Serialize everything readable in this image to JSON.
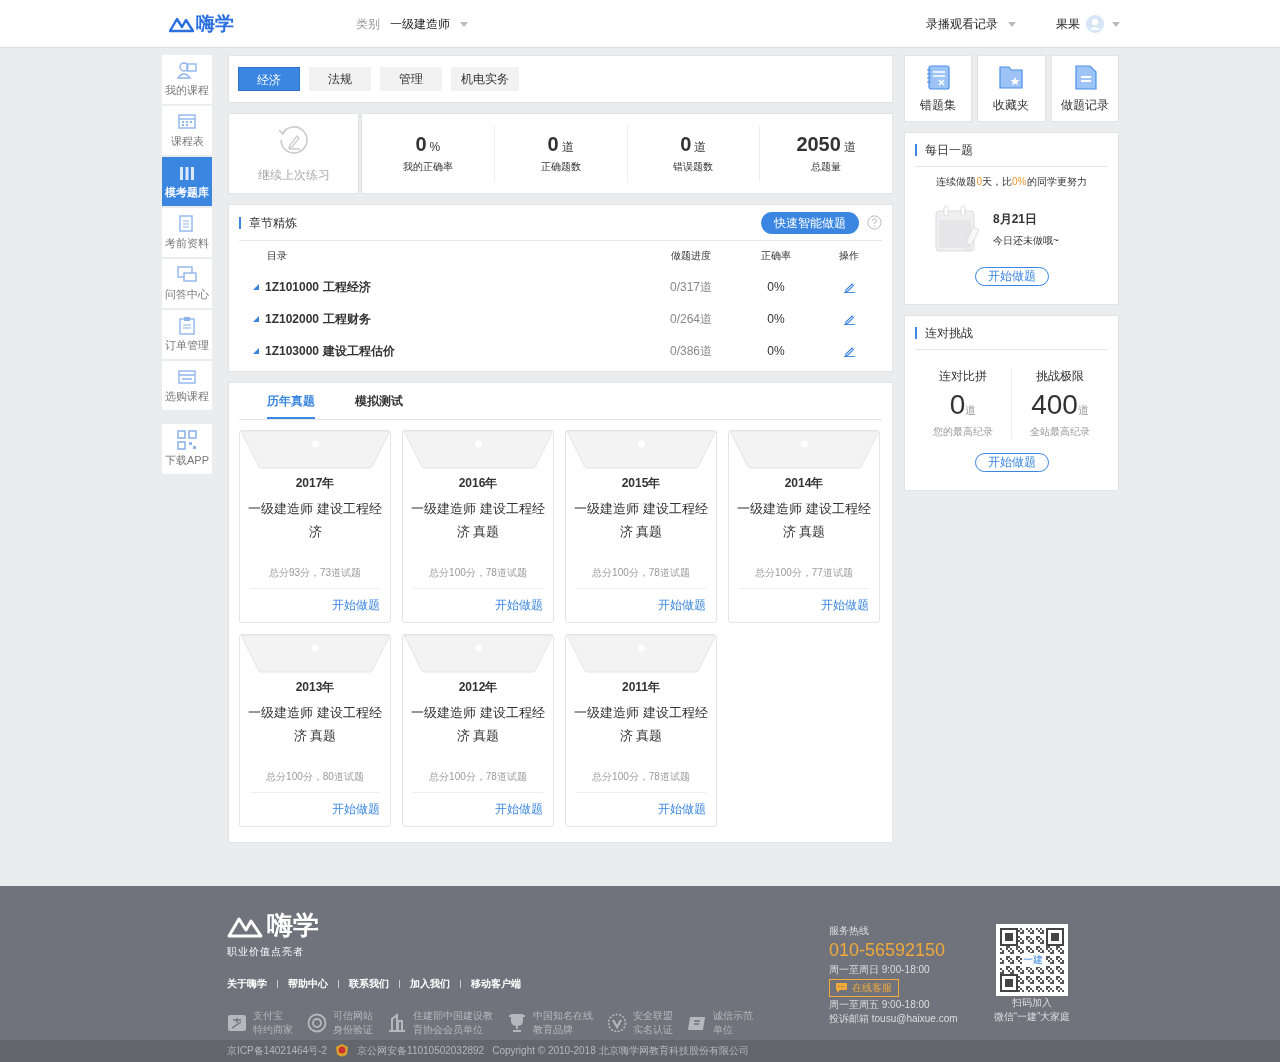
{
  "header": {
    "logo": "嗨学",
    "category_label": "类别",
    "category_value": "一级建造师",
    "history_link": "录播观看记录",
    "user_name": "果果"
  },
  "sidebar": {
    "items": [
      {
        "label": "我的课程",
        "selected": false
      },
      {
        "label": "课程表",
        "selected": false
      },
      {
        "label": "模考题库",
        "selected": true
      },
      {
        "label": "考前资料",
        "selected": false
      },
      {
        "label": "问答中心",
        "selected": false
      },
      {
        "label": "订单管理",
        "selected": false
      },
      {
        "label": "选购课程",
        "selected": false
      }
    ],
    "download": "下载APP"
  },
  "subject_tabs": [
    {
      "label": "经济",
      "selected": true
    },
    {
      "label": "法规",
      "selected": false
    },
    {
      "label": "管理",
      "selected": false
    },
    {
      "label": "机电实务",
      "selected": false
    }
  ],
  "continue_label": "继续上次练习",
  "stats": [
    {
      "value": "0",
      "unit": "%",
      "label": "我的正确率"
    },
    {
      "value": "0",
      "unit": "道",
      "label": "正确题数"
    },
    {
      "value": "0",
      "unit": "道",
      "label": "错误题数"
    },
    {
      "value": "2050",
      "unit": "道",
      "label": "总题量"
    }
  ],
  "chapters": {
    "title": "章节精炼",
    "button": "快速智能做题",
    "columns": [
      "目录",
      "做题进度",
      "正确率",
      "操作"
    ],
    "rows": [
      {
        "code": "1Z101000",
        "name": "工程经济",
        "progress": "0/317道",
        "rate": "0%"
      },
      {
        "code": "1Z102000",
        "name": "工程财务",
        "progress": "0/264道",
        "rate": "0%"
      },
      {
        "code": "1Z103000",
        "name": "建设工程估价",
        "progress": "0/386道",
        "rate": "0%"
      }
    ]
  },
  "papers": {
    "tabs": [
      {
        "label": "历年真题",
        "selected": true
      },
      {
        "label": "模拟测试",
        "selected": false
      }
    ],
    "items": [
      {
        "year": "2017年",
        "title": "一级建造师 建设工程经济",
        "meta": "总分93分，73道试题",
        "action": "开始做题"
      },
      {
        "year": "2016年",
        "title": "一级建造师 建设工程经济 真题",
        "meta": "总分100分，78道试题",
        "action": "开始做题"
      },
      {
        "year": "2015年",
        "title": "一级建造师 建设工程经济 真题",
        "meta": "总分100分，78道试题",
        "action": "开始做题"
      },
      {
        "year": "2014年",
        "title": "一级建造师 建设工程经济 真题",
        "meta": "总分100分，77道试题",
        "action": "开始做题"
      },
      {
        "year": "2013年",
        "title": "一级建造师 建设工程经济 真题",
        "meta": "总分100分，80道试题",
        "action": "开始做题"
      },
      {
        "year": "2012年",
        "title": "一级建造师 建设工程经济 真题",
        "meta": "总分100分，78道试题",
        "action": "开始做题"
      },
      {
        "year": "2011年",
        "title": "一级建造师 建设工程经济 真题",
        "meta": "总分100分，78道试题",
        "action": "开始做题"
      }
    ]
  },
  "tools": [
    {
      "label": "错题集"
    },
    {
      "label": "收藏夹"
    },
    {
      "label": "做题记录"
    }
  ],
  "daily": {
    "title": "每日一题",
    "streak": [
      {
        "text": "连续做题",
        "highlight": false
      },
      {
        "text": "0",
        "highlight": true
      },
      {
        "text": "天，比",
        "highlight": false
      },
      {
        "text": "0%",
        "highlight": true
      },
      {
        "text": "的同学更努力",
        "highlight": false
      }
    ],
    "date": "8月21日",
    "note": "今日还未做哦~",
    "button": "开始做题"
  },
  "challenge": {
    "title": "连对挑战",
    "items": [
      {
        "label": "连对比拼",
        "value": "0",
        "unit": "道",
        "caption": "您的最高纪录"
      },
      {
        "label": "挑战极限",
        "value": "400",
        "unit": "道",
        "caption": "全站最高纪录"
      }
    ],
    "button": "开始做题"
  },
  "footer": {
    "logo": "嗨学",
    "slogan": "职业价值点亮者",
    "links": [
      "关于嗨学",
      "帮助中心",
      "联系我们",
      "加入我们",
      "移动客户端"
    ],
    "badges": [
      {
        "line1": "支付宝",
        "line2": "特约商家"
      },
      {
        "line1": "可信网站",
        "line2": "身份验证"
      },
      {
        "line1": "住建部中国建设教",
        "line2": "育协会会员单位"
      },
      {
        "line1": "中国知名在线",
        "line2": "教育品牌"
      },
      {
        "line1": "安全联盟",
        "line2": "实名认证"
      },
      {
        "line1": "诚信示范",
        "line2": "单位"
      }
    ],
    "hotline_label": "服务热线",
    "phone": "010-56592150",
    "hours": "周一至周日 9:00-18:00",
    "service_button": "在线客服",
    "hours2": "周一至周五 9:00-18:00",
    "email": "投诉邮箱 tousu@haixue.com",
    "qr_center": "一建",
    "qr_caption1": "扫码加入",
    "qr_caption2": "微信“一建”大家庭",
    "icp": "京ICP备14021464号-2",
    "police": "京公网安备11010502032892",
    "copyright": "Copyright © 2010-2018 北京嗨学网教育科技股份有限公司"
  }
}
